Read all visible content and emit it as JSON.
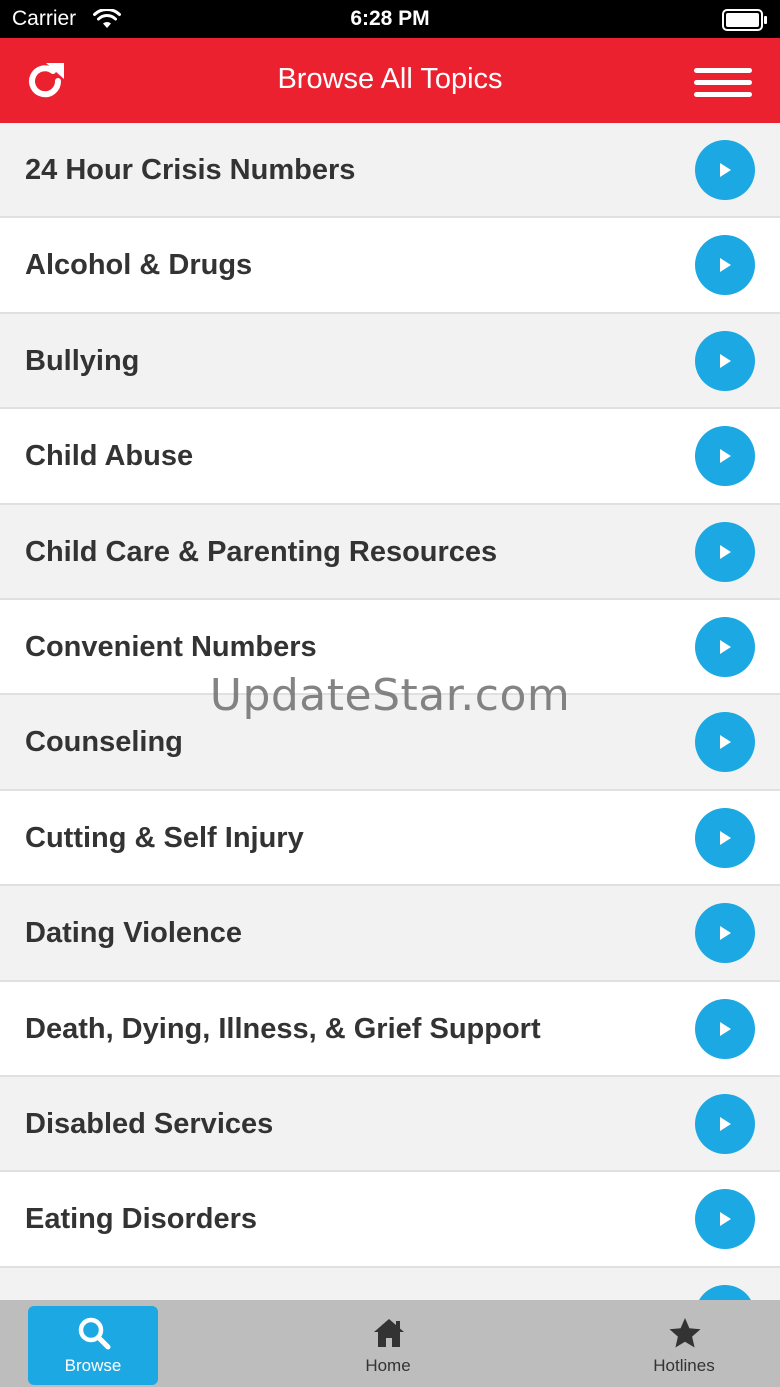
{
  "status_bar": {
    "carrier": "Carrier",
    "time": "6:28 PM"
  },
  "header": {
    "title": "Browse All Topics",
    "left_icon": "refresh-icon",
    "right_icon": "menu-icon",
    "background_color": "#ec2130"
  },
  "topics": [
    "24 Hour Crisis Numbers",
    "Alcohol & Drugs",
    "Bullying",
    "Child Abuse",
    "Child Care & Parenting Resources",
    "Convenient Numbers",
    "Counseling",
    "Cutting & Self Injury",
    "Dating Violence",
    "Death, Dying, Illness, & Grief Support",
    "Disabled Services",
    "Eating Disorders",
    ""
  ],
  "row_button_icon": "play-arrow-icon",
  "accent_color": "#1ba8e3",
  "watermark": "UpdateStar.com",
  "tab_bar": {
    "tabs": [
      {
        "label": "Browse",
        "icon": "search-icon",
        "active": true
      },
      {
        "label": "Home",
        "icon": "home-icon",
        "active": false
      },
      {
        "label": "Hotlines",
        "icon": "star-icon",
        "active": false
      }
    ]
  }
}
